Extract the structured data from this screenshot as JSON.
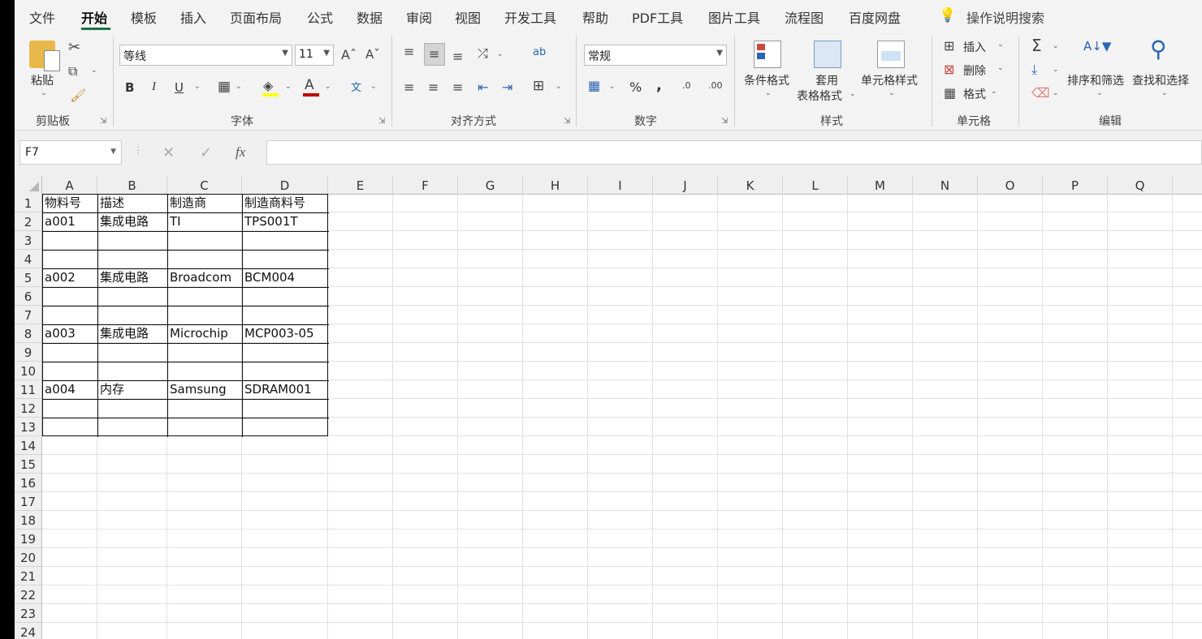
{
  "menu": {
    "tabs": [
      "文件",
      "开始",
      "模板",
      "插入",
      "页面布局",
      "公式",
      "数据",
      "审阅",
      "视图",
      "开发工具",
      "帮助",
      "PDF工具",
      "图片工具",
      "流程图",
      "百度网盘"
    ],
    "active": "开始",
    "search_label": "操作说明搜索"
  },
  "ribbon": {
    "clipboard": {
      "paste": "粘贴",
      "label": "剪贴板"
    },
    "font": {
      "name": "等线",
      "size": "11",
      "bold": "B",
      "italic": "I",
      "underline": "U",
      "label": "字体"
    },
    "alignment": {
      "label": "对齐方式"
    },
    "number": {
      "format": "常规",
      "percent": "%",
      "comma": ",",
      "label": "数字"
    },
    "styles": {
      "conditional": "条件格式",
      "table1": "套用",
      "table2": "表格格式",
      "cell_styles": "单元格样式",
      "label": "样式"
    },
    "cells": {
      "insert": "插入",
      "delete": "删除",
      "format": "格式",
      "label": "单元格"
    },
    "editing": {
      "sort": "排序和筛选",
      "find": "查找和选择",
      "label": "编辑"
    }
  },
  "formula_bar": {
    "name_box": "F7",
    "fx": "fx",
    "value": ""
  },
  "sheet": {
    "columns": [
      "A",
      "B",
      "C",
      "D",
      "E",
      "F",
      "G",
      "H",
      "I",
      "J",
      "K",
      "L",
      "M",
      "N",
      "O",
      "P",
      "Q"
    ],
    "rows": [
      "1",
      "2",
      "3",
      "4",
      "5",
      "6",
      "7",
      "8",
      "9",
      "10",
      "11",
      "12",
      "13",
      "14",
      "15",
      "16",
      "17",
      "18",
      "19",
      "20",
      "21",
      "22",
      "23",
      "24"
    ],
    "cells": {
      "A1": "物料号",
      "B1": "描述",
      "C1": "制造商",
      "D1": "制造商料号",
      "A2": "a001",
      "B2": "集成电路",
      "C2": "TI",
      "D2": "TPS001T",
      "A5": "a002",
      "B5": "集成电路",
      "C5": "Broadcom",
      "D5": "BCM004",
      "A8": "a003",
      "B8": "集成电路",
      "C8": "Microchip",
      "D8": "MCP003-05",
      "A11": "a004",
      "B11": "内存",
      "C11": "Samsung",
      "D11": "SDRAM001"
    },
    "selected": "F7"
  },
  "colors": {
    "accent": "#1e7145",
    "grid": "#e1e1e1",
    "border": "#111111"
  }
}
